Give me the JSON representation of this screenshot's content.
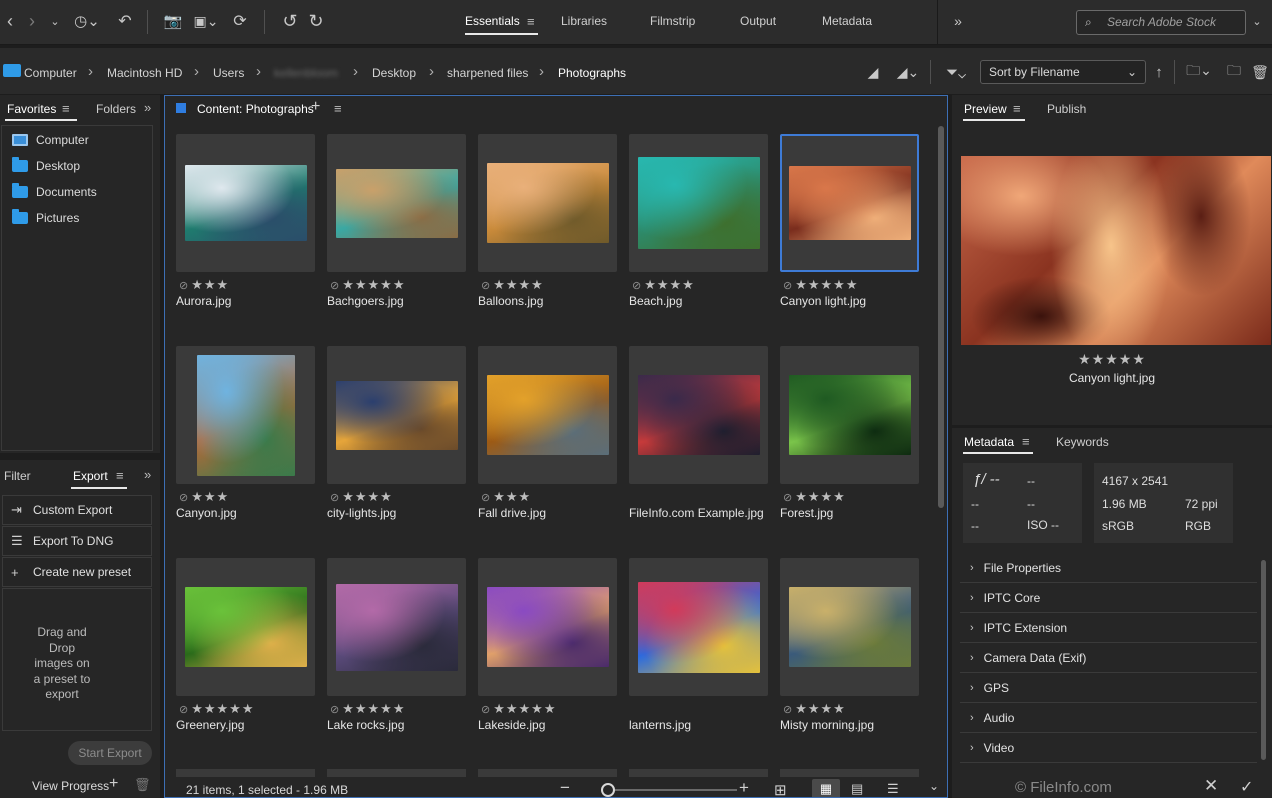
{
  "workspace_tabs": [
    "Essentials",
    "Libraries",
    "Filmstrip",
    "Output",
    "Metadata"
  ],
  "search": {
    "placeholder": "Search Adobe Stock"
  },
  "path": {
    "items": [
      "Computer",
      "Macintosh HD",
      "Users",
      "kellenbloom",
      "Desktop",
      "sharpened files",
      "Photographs"
    ]
  },
  "sort": {
    "label": "Sort by Filename"
  },
  "left_tabs": {
    "favorites": "Favorites",
    "folders": "Folders"
  },
  "favorites": [
    "Computer",
    "Desktop",
    "Documents",
    "Pictures"
  ],
  "bottom_left_tabs": {
    "filter": "Filter",
    "export": "Export"
  },
  "export_items": [
    "Custom Export",
    "Export To DNG",
    "Create new preset"
  ],
  "export_hint": "Drag and\nDrop\nimages on\na preset to\nexport",
  "start_export": "Start Export",
  "view_progress": "View Progress",
  "content": {
    "title": "Content: Photographs",
    "status": "21 items, 1 selected - 1.96 MB",
    "items": [
      {
        "name": "Aurora.jpg",
        "stars": 3,
        "colors": [
          "#dfe8ee",
          "#1f7b6e",
          "#2b4d6a"
        ],
        "w": 122,
        "h": 76
      },
      {
        "name": "Bachgoers.jpg",
        "stars": 5,
        "colors": [
          "#c9a06a",
          "#3aa8a3",
          "#8a6c45"
        ],
        "w": 122,
        "h": 69
      },
      {
        "name": "Balloons.jpg",
        "stars": 4,
        "colors": [
          "#e9b07a",
          "#c98a3a",
          "#6f5a2a"
        ],
        "w": 122,
        "h": 80
      },
      {
        "name": "Beach.jpg",
        "stars": 4,
        "colors": [
          "#28b8b0",
          "#2d8a6a",
          "#3e6f2d"
        ],
        "w": 122,
        "h": 92
      },
      {
        "name": "Canyon light.jpg",
        "stars": 5,
        "colors": [
          "#d9774a",
          "#7a2d1d",
          "#f0b07a"
        ],
        "w": 122,
        "h": 74,
        "selected": true
      },
      {
        "name": "Canyon.jpg",
        "stars": 3,
        "colors": [
          "#6fb3e0",
          "#b06a3a",
          "#3a7a4a"
        ],
        "w": 98,
        "h": 121
      },
      {
        "name": "city-lights.jpg",
        "stars": 4,
        "colors": [
          "#2b3f6e",
          "#e6a53a",
          "#6a4a2a"
        ],
        "w": 122,
        "h": 69
      },
      {
        "name": "Fall drive.jpg",
        "stars": 3,
        "colors": [
          "#e3a12a",
          "#9c5a15",
          "#5a6e7a"
        ],
        "w": 122,
        "h": 80
      },
      {
        "name": "FileInfo.com Example.jpg",
        "stars": 0,
        "colors": [
          "#3a2a4a",
          "#c63a3a",
          "#1e1e2e"
        ],
        "w": 122,
        "h": 80
      },
      {
        "name": "Forest.jpg",
        "stars": 4,
        "colors": [
          "#1f5a22",
          "#7ac44a",
          "#0d2a10"
        ],
        "w": 122,
        "h": 80
      },
      {
        "name": "Greenery.jpg",
        "stars": 5,
        "colors": [
          "#6ac23a",
          "#2a6a1a",
          "#e0b04a"
        ],
        "w": 122,
        "h": 80
      },
      {
        "name": "Lake rocks.jpg",
        "stars": 5,
        "colors": [
          "#b36aa8",
          "#5a4a7a",
          "#2a2a3a"
        ],
        "w": 122,
        "h": 87
      },
      {
        "name": "Lakeside.jpg",
        "stars": 5,
        "colors": [
          "#8a4ac2",
          "#e0a06a",
          "#4a2a6a"
        ],
        "w": 122,
        "h": 80
      },
      {
        "name": "lanterns.jpg",
        "stars": 0,
        "colors": [
          "#d23a5a",
          "#2a6ae0",
          "#e6c23a"
        ],
        "w": 122,
        "h": 91
      },
      {
        "name": "Misty morning.jpg",
        "stars": 4,
        "colors": [
          "#c9b06a",
          "#3a5a7a",
          "#6a7a3a"
        ],
        "w": 122,
        "h": 80
      }
    ]
  },
  "preview": {
    "tab": "Preview",
    "publish": "Publish",
    "filename": "Canyon light.jpg",
    "stars": 5
  },
  "metadata": {
    "tab": "Metadata",
    "keywords": "Keywords",
    "left": {
      "f": "ƒ/ --",
      "shutter": "--",
      "r2a": "--",
      "r2b": "--",
      "r3a": "--",
      "iso": "ISO --"
    },
    "right": {
      "dims": "4167 x 2541",
      "size": "1.96 MB",
      "ppi": "72 ppi",
      "profile": "sRGB",
      "mode": "RGB"
    },
    "sections": [
      "File Properties",
      "IPTC Core",
      "IPTC Extension",
      "Camera Data (Exif)",
      "GPS",
      "Audio",
      "Video"
    ]
  },
  "watermark": "© FileInfo.com"
}
